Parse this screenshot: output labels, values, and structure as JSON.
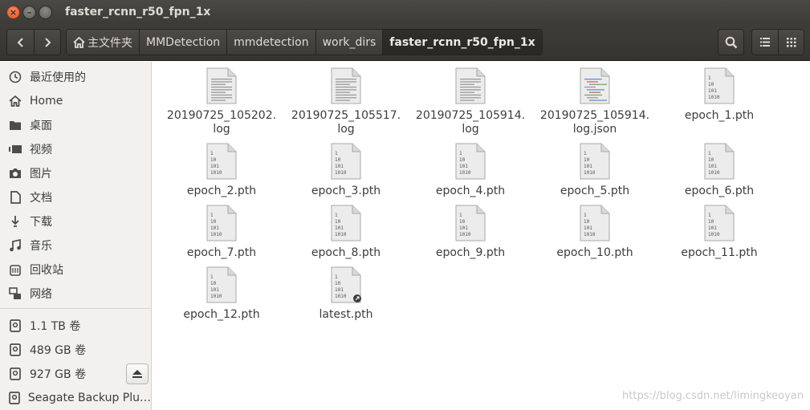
{
  "window": {
    "title": "faster_rcnn_r50_fpn_1x",
    "close_glyph": "×",
    "min_glyph": "–",
    "max_glyph": "□"
  },
  "breadcrumbs": [
    "主文件夹",
    "MMDetection",
    "mmdetection",
    "work_dirs",
    "faster_rcnn_r50_fpn_1x"
  ],
  "sidebar": {
    "places": [
      {
        "label": "最近使用的",
        "icon": "clock-icon"
      },
      {
        "label": "Home",
        "icon": "home-icon"
      },
      {
        "label": "桌面",
        "icon": "folder-icon"
      },
      {
        "label": "视频",
        "icon": "video-icon"
      },
      {
        "label": "图片",
        "icon": "camera-icon"
      },
      {
        "label": "文档",
        "icon": "document-icon"
      },
      {
        "label": "下载",
        "icon": "download-icon"
      },
      {
        "label": "音乐",
        "icon": "music-icon"
      },
      {
        "label": "回收站",
        "icon": "trash-icon"
      },
      {
        "label": "网络",
        "icon": "network-icon"
      }
    ],
    "devices": [
      {
        "label": "1.1 TB 卷",
        "icon": "drive-icon"
      },
      {
        "label": "489 GB 卷",
        "icon": "drive-icon"
      },
      {
        "label": "927 GB 卷",
        "icon": "drive-icon"
      },
      {
        "label": "Seagate Backup Plu…",
        "icon": "drive-icon"
      }
    ]
  },
  "files": [
    {
      "name": "20190725_105202.\nlog",
      "type": "text"
    },
    {
      "name": "20190725_105517.\nlog",
      "type": "text"
    },
    {
      "name": "20190725_105914.\nlog",
      "type": "text"
    },
    {
      "name": "20190725_105914.\nlog.json",
      "type": "json"
    },
    {
      "name": "epoch_1.pth",
      "type": "binary"
    },
    {
      "name": "epoch_2.pth",
      "type": "binary"
    },
    {
      "name": "epoch_3.pth",
      "type": "binary"
    },
    {
      "name": "epoch_4.pth",
      "type": "binary"
    },
    {
      "name": "epoch_5.pth",
      "type": "binary"
    },
    {
      "name": "epoch_6.pth",
      "type": "binary"
    },
    {
      "name": "epoch_7.pth",
      "type": "binary"
    },
    {
      "name": "epoch_8.pth",
      "type": "binary"
    },
    {
      "name": "epoch_9.pth",
      "type": "binary"
    },
    {
      "name": "epoch_10.pth",
      "type": "binary"
    },
    {
      "name": "epoch_11.pth",
      "type": "binary"
    },
    {
      "name": "epoch_12.pth",
      "type": "binary"
    },
    {
      "name": "latest.pth",
      "type": "binary-link"
    }
  ],
  "binary_icon_text": [
    "1",
    "10",
    "101",
    "1010"
  ],
  "watermark": "https://blog.csdn.net/limingkeoyan"
}
